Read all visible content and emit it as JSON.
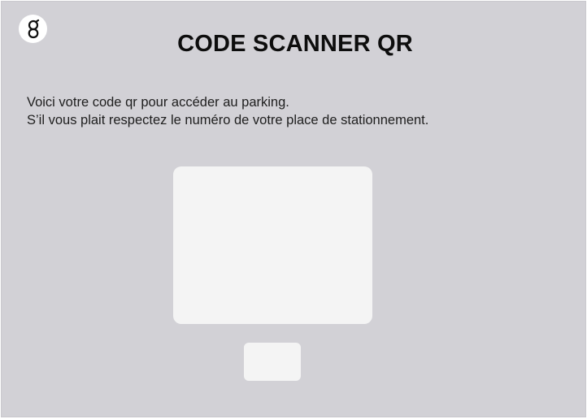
{
  "app": {
    "logo_icon": "g-logo-icon",
    "title": "CODE SCANNER QR"
  },
  "message": {
    "line1": "Voici votre code qr pour accéder au parking.",
    "line2": "S’il vous plait respectez le numéro de votre place de stationnement."
  },
  "colors": {
    "background": "#d2d1d6",
    "card": "#f4f4f4",
    "text": "#0d0d0d"
  }
}
